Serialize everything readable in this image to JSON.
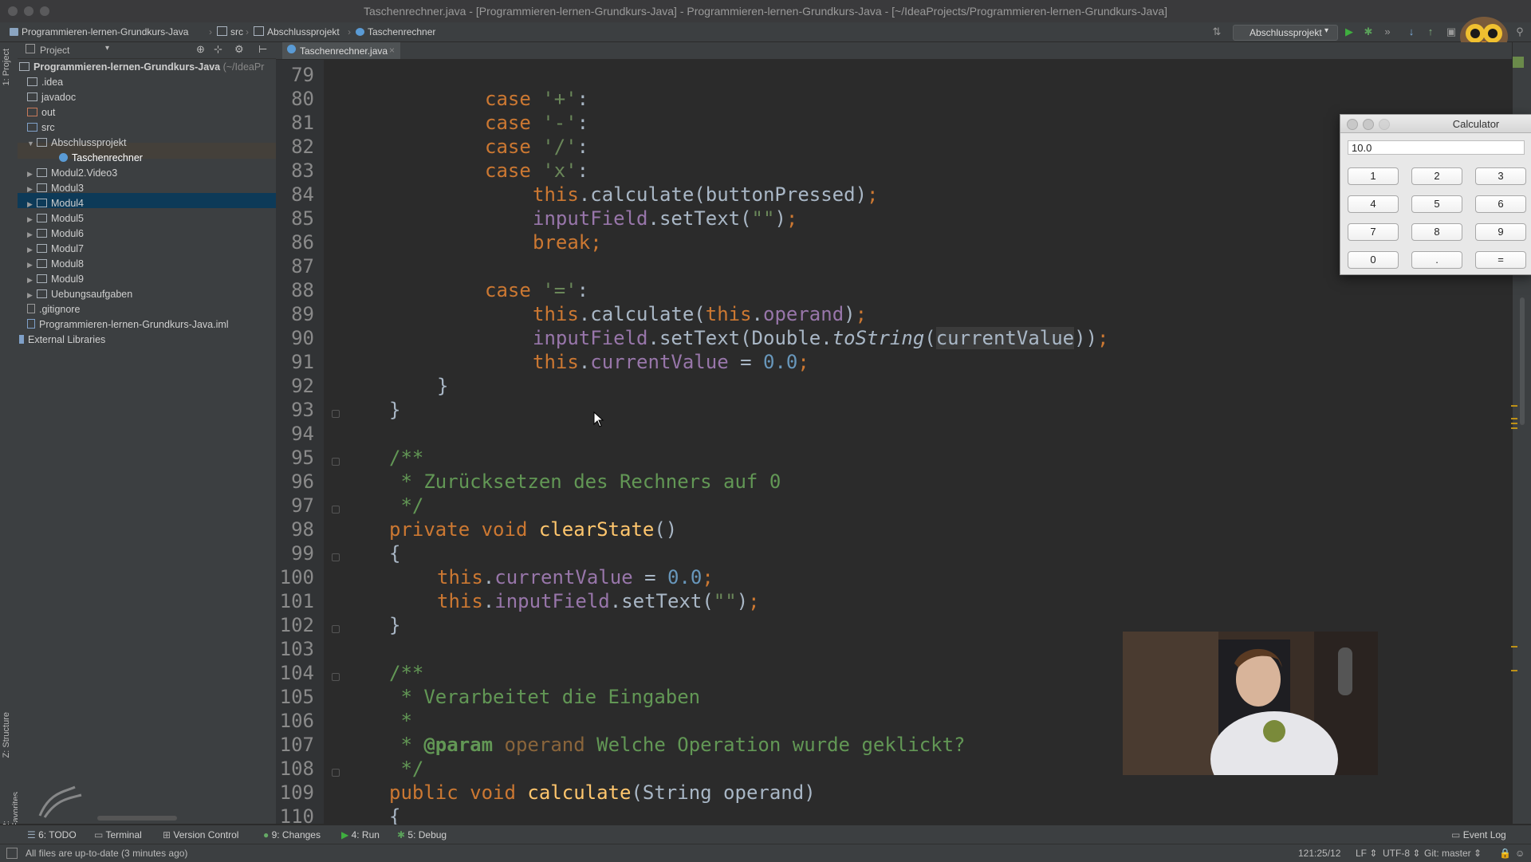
{
  "window": {
    "title": "Taschenrechner.java - [Programmieren-lernen-Grundkurs-Java] - Programmieren-lernen-Grundkurs-Java - [~/IdeaProjects/Programmieren-lernen-Grundkurs-Java]"
  },
  "navbar": {
    "crumbs": [
      "Programmieren-lernen-Grundkurs-Java",
      "src",
      "Abschlussprojekt",
      "Taschenrechner"
    ],
    "run_config": "Abschlussprojekt"
  },
  "left_strip": {
    "project_tab": "1: Project",
    "structure_tab": "Z: Structure",
    "favorites_tab": "2: Favorites"
  },
  "project_panel": {
    "header": "Project",
    "root": "Programmieren-lernen-Grundkurs-Java",
    "root_path": "(~/IdeaPr",
    "items": [
      {
        "label": ".idea"
      },
      {
        "label": "javadoc"
      },
      {
        "label": "out"
      },
      {
        "label": "src"
      },
      {
        "label": "Abschlussprojekt"
      },
      {
        "label": "Taschenrechner"
      },
      {
        "label": "Modul2.Video3"
      },
      {
        "label": "Modul3"
      },
      {
        "label": "Modul4"
      },
      {
        "label": "Modul5"
      },
      {
        "label": "Modul6"
      },
      {
        "label": "Modul7"
      },
      {
        "label": "Modul8"
      },
      {
        "label": "Modul9"
      },
      {
        "label": "Uebungsaufgaben"
      },
      {
        "label": ".gitignore"
      },
      {
        "label": "Programmieren-lernen-Grundkurs-Java.iml"
      },
      {
        "label": "External Libraries"
      }
    ]
  },
  "editor": {
    "tab_label": "Taschenrechner.java",
    "line_numbers": [
      "79",
      "80",
      "81",
      "82",
      "83",
      "84",
      "85",
      "86",
      "87",
      "88",
      "89",
      "90",
      "91",
      "92",
      "93",
      "94",
      "95",
      "96",
      "97",
      "98",
      "99",
      "100",
      "101",
      "102",
      "103",
      "104",
      "105",
      "106",
      "107",
      "108",
      "109",
      "110"
    ]
  },
  "calculator": {
    "title": "Calculator",
    "display": "10.0",
    "buttons": [
      "1",
      "2",
      "3",
      "4",
      "5",
      "6",
      "7",
      "8",
      "9",
      "0",
      ".",
      "="
    ]
  },
  "bottom_tabs": {
    "todo": "6: TODO",
    "terminal": "Terminal",
    "vcs": "Version Control",
    "changes": "9: Changes",
    "run": "4: Run",
    "debug": "5: Debug",
    "event_log": "Event Log"
  },
  "status": {
    "message": "All files are up-to-date (3 minutes ago)",
    "position": "121:25/12",
    "line_sep": "LF",
    "encoding": "UTF-8",
    "git": "Git: master"
  },
  "colors": {
    "keyword": "#cc7832",
    "string": "#6a8759",
    "number": "#6897bb",
    "field": "#9876aa",
    "method": "#ffc66d",
    "comment": "#629755",
    "editor_bg": "#2b2b2b"
  }
}
